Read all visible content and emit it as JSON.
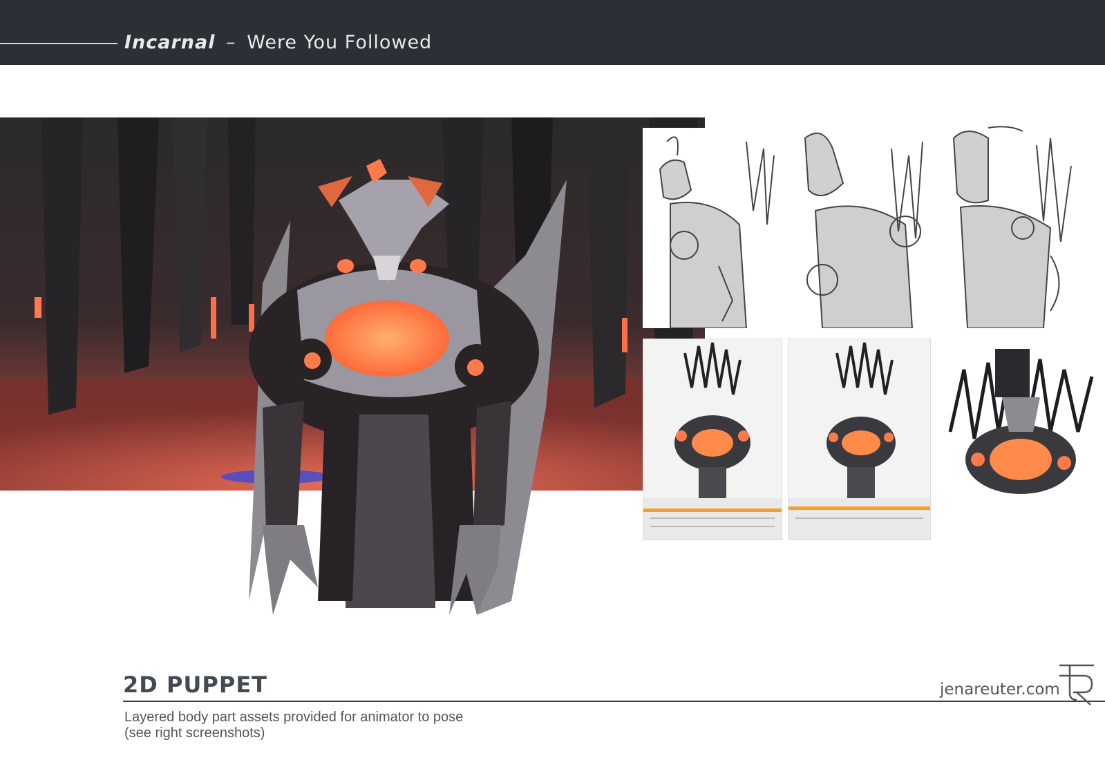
{
  "header": {
    "title_em": "Incarnal",
    "title_dash": "–",
    "title_rest": "Were You Followed"
  },
  "footer": {
    "section_title": "2D PUPPET",
    "description_line1": "Layered body part assets provided for animator to pose",
    "description_line2": "(see right screenshots)",
    "website": "jenareuter.com"
  },
  "colors": {
    "header_bg": "#2b2f36",
    "accent_orange": "#ff8a4a",
    "scene_red": "#d8544a"
  },
  "images": {
    "main_scene": "concept painting: dark monster character in red-lit room",
    "sketches": [
      "sketch-pose-1",
      "sketch-pose-2",
      "sketch-pose-3"
    ],
    "puppet_screens": [
      "animation-screenshot-1",
      "animation-screenshot-2",
      "puppet-render"
    ]
  }
}
